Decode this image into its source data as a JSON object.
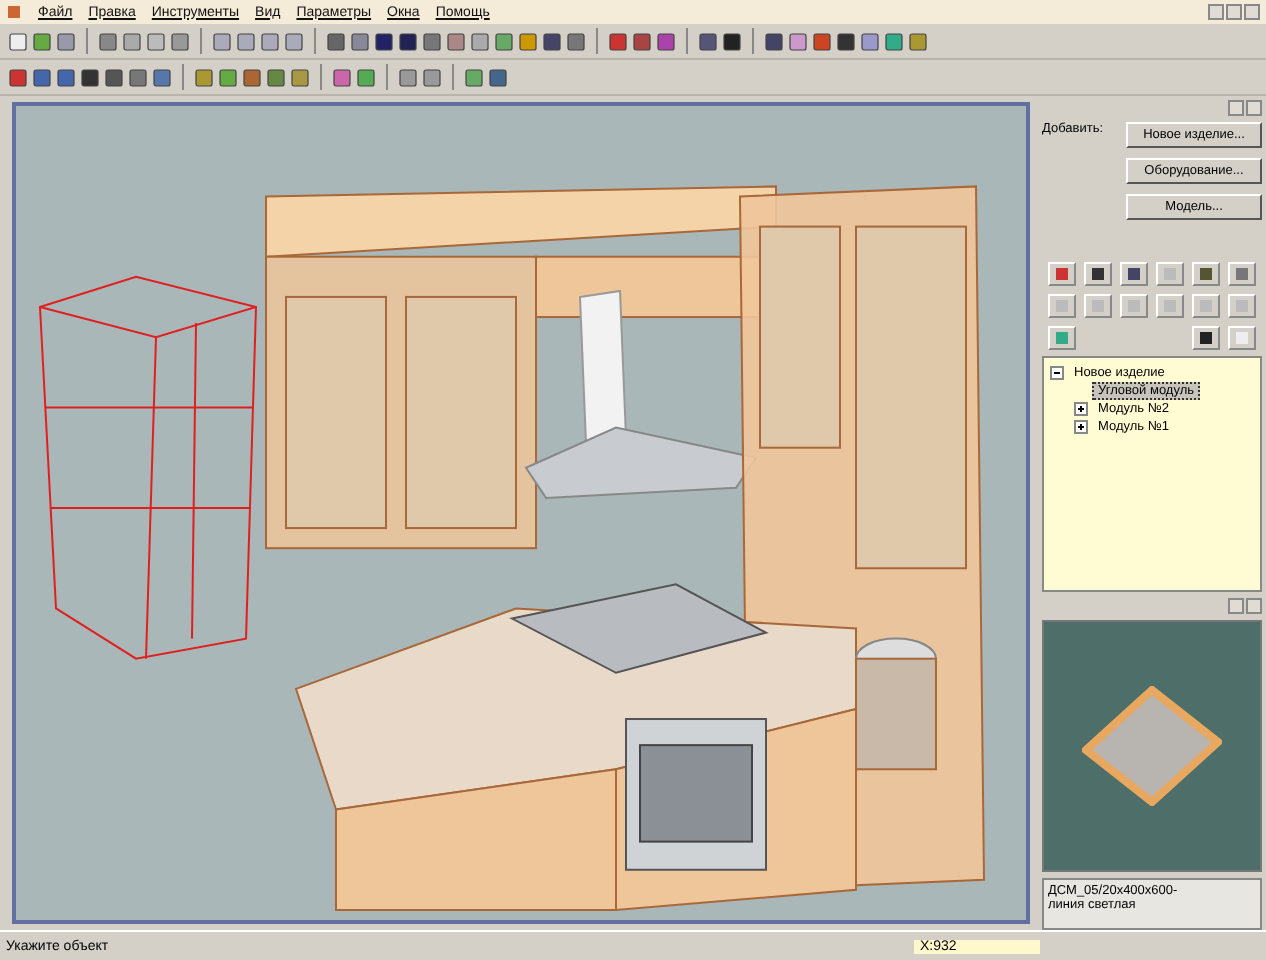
{
  "menu": [
    "Файл",
    "Правка",
    "Инструменты",
    "Вид",
    "Параметры",
    "Окна",
    "Помощь"
  ],
  "add_panel": {
    "label": "Добавить:",
    "buttons": [
      "Новое изделие...",
      "Оборудование...",
      "Модель..."
    ]
  },
  "tree": [
    {
      "label": "Новое изделие",
      "expanded": true,
      "selected": false,
      "children": [
        {
          "label": "Угловой модуль",
          "selected": true
        },
        {
          "label": "Модуль №2",
          "expanded": false,
          "selected": false
        },
        {
          "label": "Модуль №1",
          "expanded": false,
          "selected": false
        }
      ]
    }
  ],
  "preview": {
    "caption": [
      "ДСМ_05/20x400x600-",
      "линия светлая"
    ]
  },
  "status_bar": {
    "message": "Укажите объект",
    "coordinate": "X:932"
  }
}
